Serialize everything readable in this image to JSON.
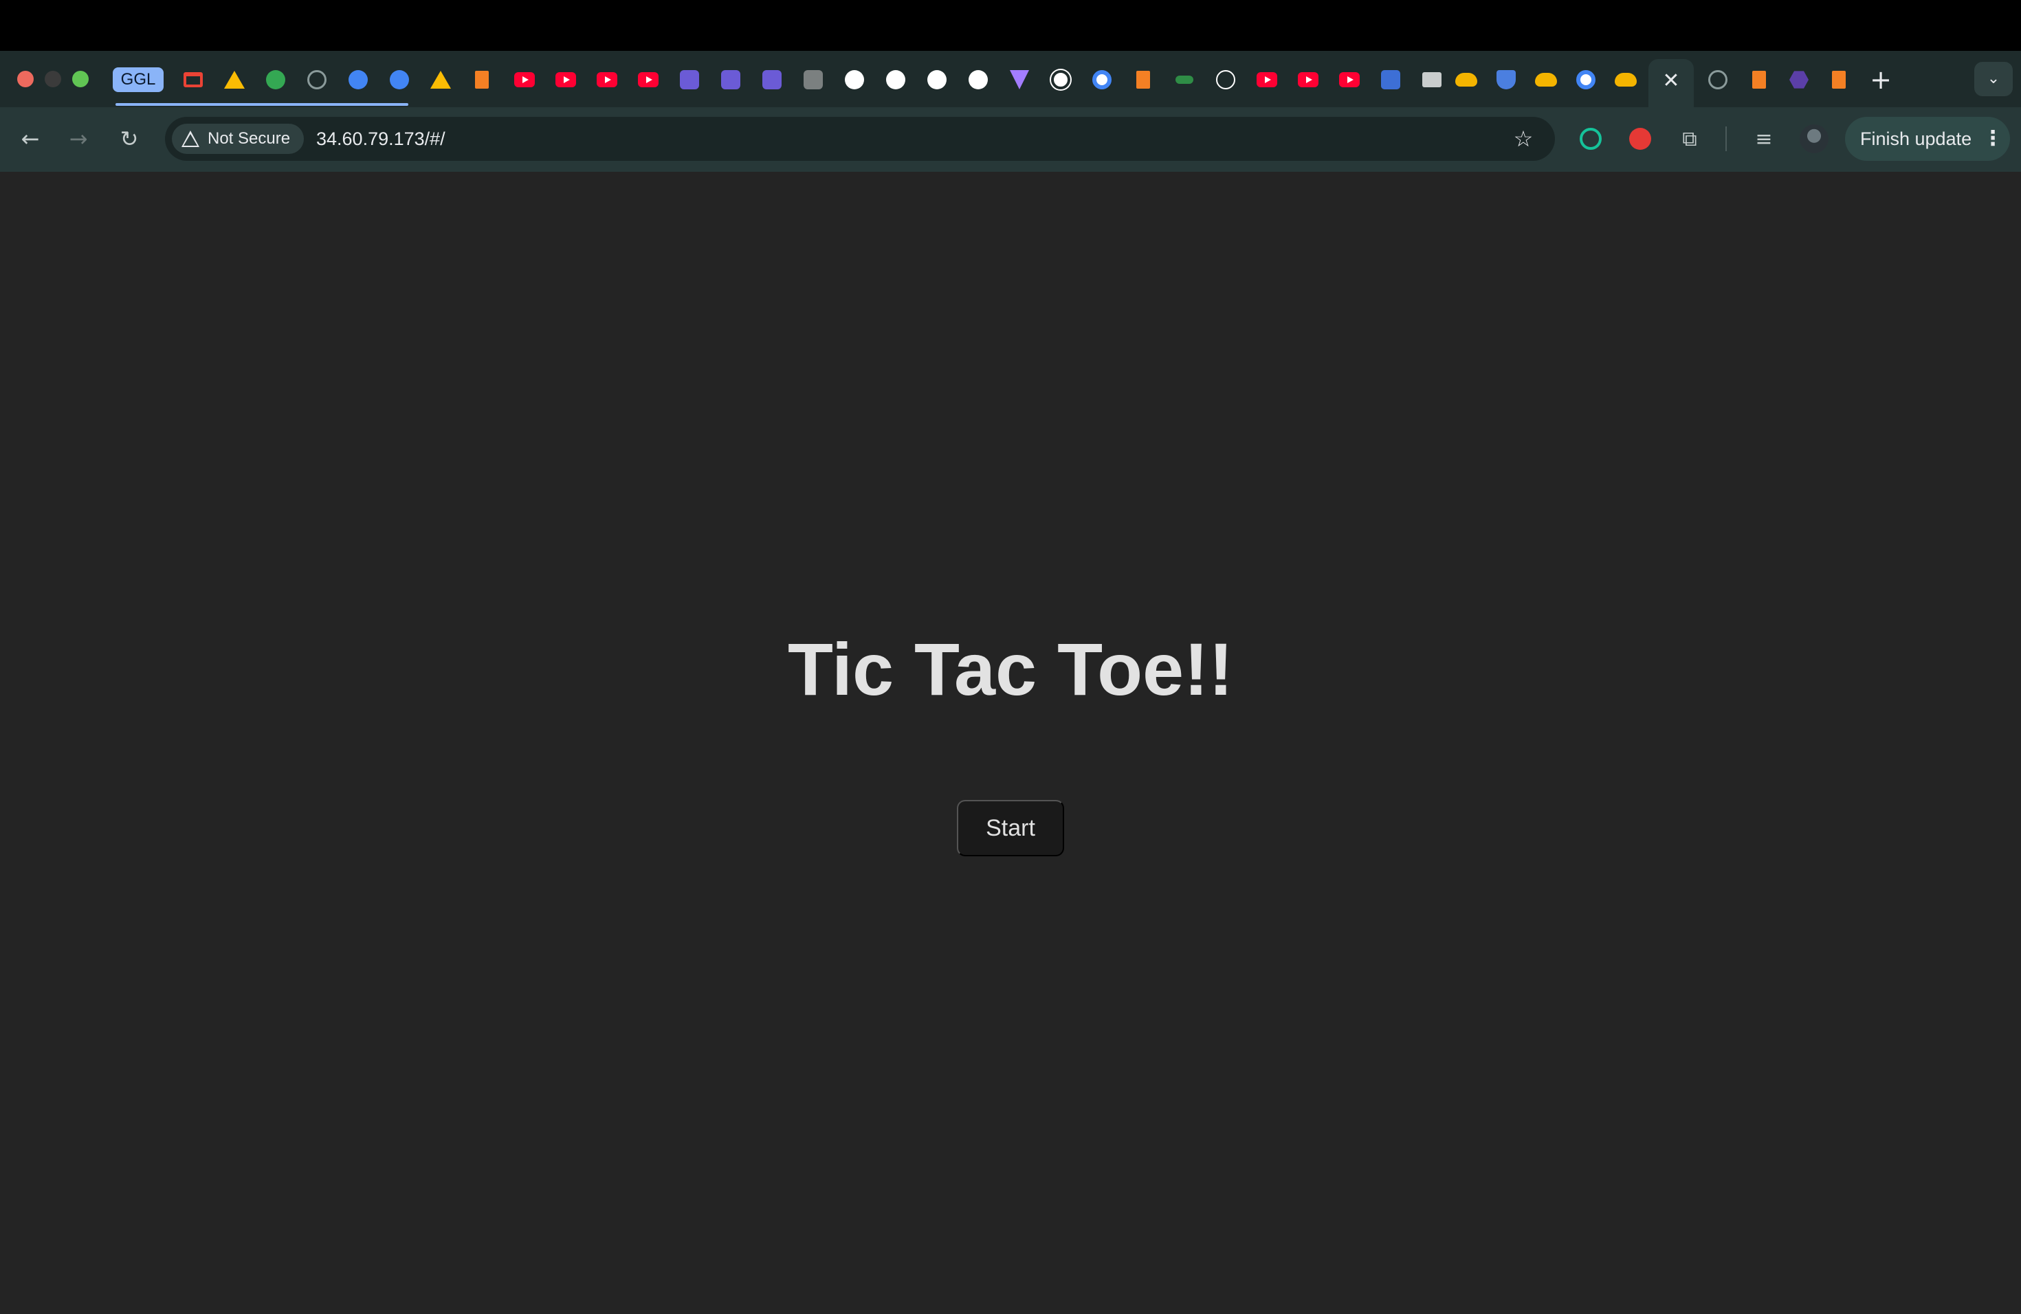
{
  "browser": {
    "tab_group_label": "GGL",
    "tab_favicons": [
      "gmail-icon",
      "google-drive-icon",
      "google-chat-icon",
      "extension-page-icon",
      "google-docs-icon",
      "google-docs-icon",
      "google-drive-icon",
      "colab-icon",
      "youtube-icon",
      "youtube-icon",
      "youtube-icon",
      "youtube-icon",
      "app-icon",
      "app-icon",
      "app-icon",
      "cube-icon",
      "github-icon",
      "github-icon",
      "github-icon",
      "github-icon",
      "vite-icon",
      "openai-icon",
      "google-icon",
      "stackoverflow-icon",
      "link-icon",
      "m-icon",
      "youtube-icon",
      "youtube-icon",
      "youtube-icon",
      "chip-icon",
      "terminal-icon",
      "google-cloud-icon",
      "shield-icon",
      "google-cloud-icon",
      "google-icon",
      "google-cloud-icon",
      "active-tab",
      "stackoverflow-icon",
      "stackoverflow-icon",
      "hexagon-icon",
      "stackoverflow-icon"
    ],
    "close_tab_glyph": "✕",
    "new_tab_glyph": "+",
    "tab_search_glyph": "⌄",
    "nav": {
      "back_glyph": "←",
      "forward_glyph": "→",
      "reload_glyph": "↻"
    },
    "omnibox": {
      "security_label": "Not Secure",
      "url": "34.60.79.173/#/",
      "bookmark_glyph": "☆"
    },
    "extensions": {
      "puzzle_glyph": "⧉",
      "media_glyph": "≡"
    },
    "finish_update_label": "Finish update",
    "menu_glyph": "⋮"
  },
  "page": {
    "title": "Tic Tac Toe!!",
    "start_button_label": "Start"
  },
  "colors": {
    "page_background": "#242424",
    "tabstrip": "#1e2b2b",
    "toolbar": "#273838",
    "accent": "#8ab4f8",
    "button_background": "#1a1a1a"
  }
}
